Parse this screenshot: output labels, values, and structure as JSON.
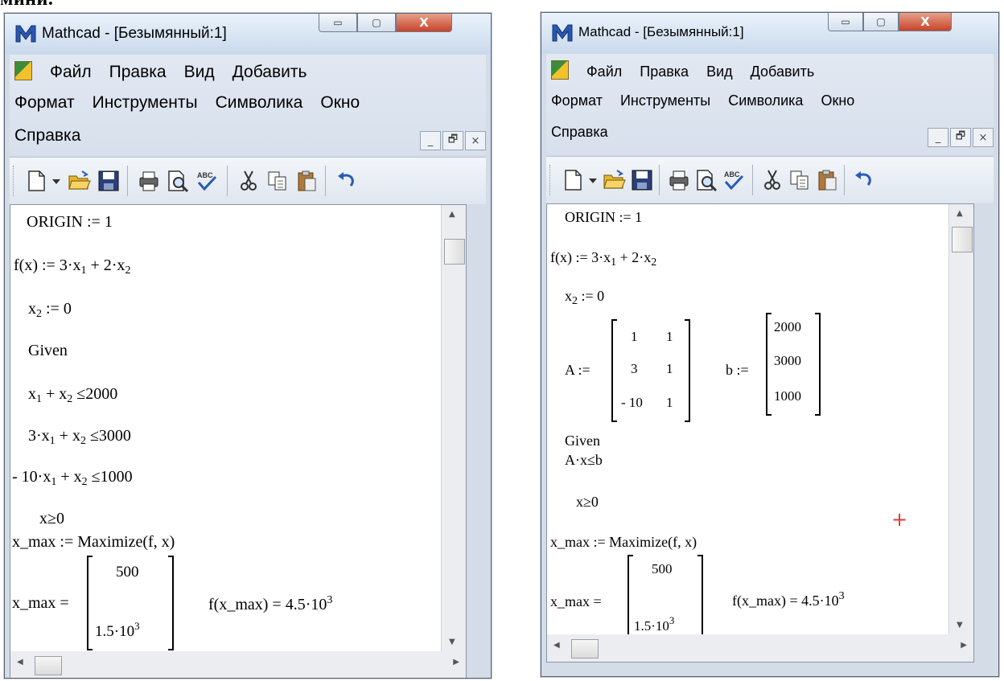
{
  "page_fragment": "мини.",
  "window": {
    "title": "Mathcad - [Безымянный:1]",
    "controls": {
      "minimize": "▭",
      "maximize": "▢",
      "close": "X"
    }
  },
  "menu": {
    "row1": [
      "Файл",
      "Правка",
      "Вид",
      "Добавить"
    ],
    "row2": [
      "Формат",
      "Инструменты",
      "Символика",
      "Окно"
    ],
    "row3": [
      "Справка"
    ],
    "mdi_controls": [
      "_",
      "🗗",
      "×"
    ]
  },
  "worksheet_left": {
    "origin": "ORIGIN := 1",
    "f_def": {
      "lhs": "f(x) := 3·x",
      "s1": "1",
      "mid": " + 2·x",
      "s2": "2"
    },
    "x2_def": {
      "a": "x",
      "s": "2",
      "b": " := 0"
    },
    "given": "Given",
    "c1": {
      "a": "x",
      "s1": "1",
      "b": " + x",
      "s2": "2",
      "c": " ≤2000"
    },
    "c2": {
      "a": "3·x",
      "s1": "1",
      "b": " + x",
      "s2": "2",
      "c": " ≤3000"
    },
    "c3": {
      "a": "- 10·x",
      "s1": "1",
      "b": " + x",
      "s2": "2",
      "c": " ≤1000"
    },
    "xge": "x≥0",
    "maximize": "x_max := Maximize(f, x)",
    "result_lhs": "x_max =",
    "result_vec": [
      "500",
      "1.5·10",
      "3"
    ],
    "f_result": {
      "a": "f(x_max) = 4.5·10",
      "sup": "3"
    }
  },
  "worksheet_right": {
    "origin": "ORIGIN := 1",
    "f_def": {
      "lhs": "f(x) := 3·x",
      "s1": "1",
      "mid": " + 2·x",
      "s2": "2"
    },
    "x2_def": {
      "a": "x",
      "s": "2",
      "b": " := 0"
    },
    "A_lhs": "A :=",
    "A_matrix": [
      [
        "1",
        "1"
      ],
      [
        "3",
        "1"
      ],
      [
        "- 10",
        "1"
      ]
    ],
    "b_lhs": "b :=",
    "b_vector": [
      "2000",
      "3000",
      "1000"
    ],
    "given": "Given",
    "constraint": "A·x≤b",
    "xge": "x≥0",
    "maximize": "x_max := Maximize(f, x)",
    "result_lhs": "x_max =",
    "result_vec": [
      "500",
      "1.5·10",
      "3"
    ],
    "f_result": {
      "a": "f(x_max) = 4.5·10",
      "sup": "3"
    },
    "cursor": "+"
  },
  "colors": {
    "titlebar": "#c9d9ec",
    "close_button": "#c8442a",
    "cursor": "#e53935"
  }
}
